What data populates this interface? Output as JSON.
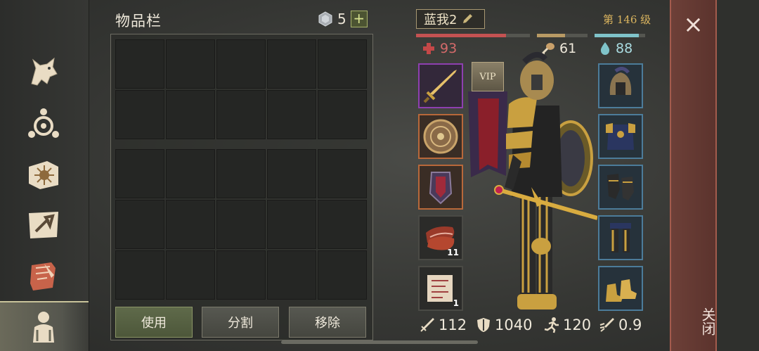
{
  "inventory": {
    "title": "物品栏",
    "gem_count": "5",
    "plus_label": "+",
    "grid_top_cells": 10,
    "grid_bottom_cells": 15,
    "buttons": {
      "use": "使用",
      "split": "分割",
      "remove": "移除"
    }
  },
  "character": {
    "name": "蓝我2",
    "level": "第 146 级",
    "health": "93",
    "food": "61",
    "water": "88",
    "health_fraction": 0.79,
    "food_fraction": 0.55,
    "water_fraction": 0.88,
    "vip_label": "VIP",
    "stack_meat": "11",
    "stack_scroll": "1",
    "attack": "112",
    "defense": "1040",
    "speed": "120",
    "attack_speed": "0.9"
  },
  "close": {
    "label": "关闭",
    "x": "×"
  },
  "colors": {
    "health": "#c45252",
    "food": "#b89a64",
    "water": "#7fc3c9",
    "accent": "#d9b35e",
    "close_bg": "#6d4038"
  },
  "nav": [
    "wolf-icon",
    "crafting-icon",
    "quest-book-icon",
    "map-icon",
    "scroll-icon",
    "character-icon"
  ]
}
